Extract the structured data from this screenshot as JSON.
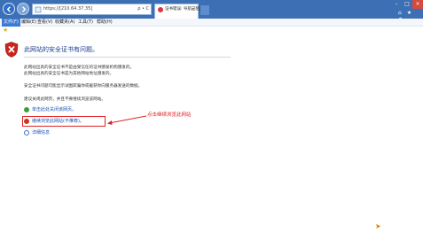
{
  "browser": {
    "address_url": "https://[210.64.37.35]",
    "address_controls": "ρ • C",
    "tab_title": "证书错误: 导航已阻止",
    "tab_close": "×",
    "window_min": "–",
    "window_max": "□",
    "window_close": "×",
    "toolbar_icons": "⌂ ★ ⚙"
  },
  "menu": {
    "file": "文件(F)",
    "edit": "编辑(E)",
    "view": "查看(V)",
    "favorites": "收藏夹(A)",
    "tools": "工具(T)",
    "help": "帮助(H)"
  },
  "content": {
    "headline": "此网站的安全证书有问题。",
    "para1": "此网站出具的安全证书不是由受信任的证书颁发机构颁发的。",
    "para2": "此网站出具的安全证书是为其他网站地址颁发的。",
    "para3": "安全证书问题可能显示试图欺骗你或截获你向服务器发送的数据。",
    "para4": "建议关闭此网页，并且不要继续浏览该网站。",
    "link_close": "单击此处关闭该网页。",
    "link_continue": "继续浏览此网站(不推荐)。",
    "link_details": "详细信息",
    "annotation": "点击继续浏览此网站"
  },
  "icons": {
    "shield": "shield-error-icon",
    "close_link": "green-shield-icon",
    "continue_link": "red-shield-icon",
    "details": "expand-circle-icon",
    "favorites": "star-icon"
  },
  "colors": {
    "titlebar": "#3c6fb4",
    "link": "#1a4fb5",
    "headline": "#1a3d8f",
    "annotation": "#e02020"
  }
}
